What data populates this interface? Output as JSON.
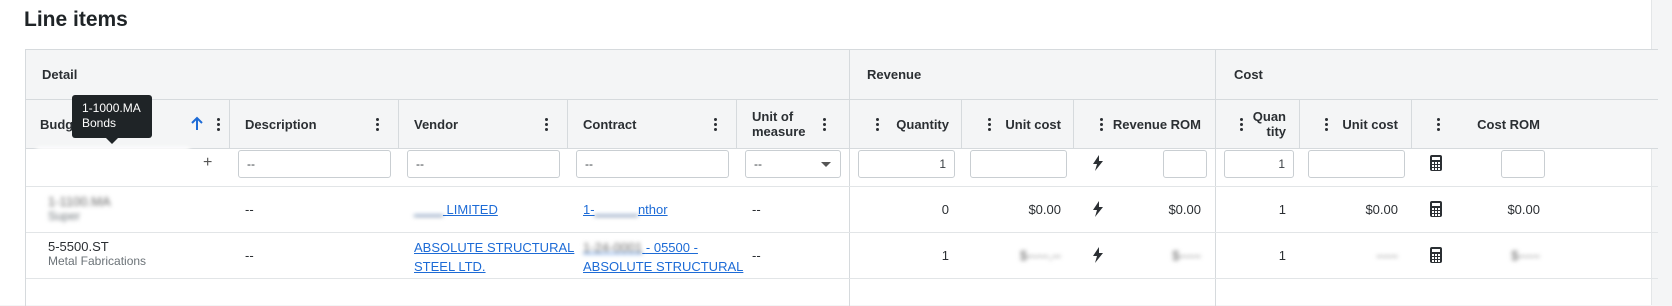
{
  "title": "Line items",
  "bands": {
    "detail": "Detail",
    "revenue": "Revenue",
    "cost": "Cost"
  },
  "columns": {
    "budget_code": "Budge",
    "description": "Description",
    "vendor": "Vendor",
    "contract": "Contract",
    "unit_of_measure_1": "Unit of",
    "unit_of_measure_2": "measure",
    "quantity": "Quantity",
    "unit_cost": "Unit cost",
    "revenue_rom": "Revenue ROM",
    "cost_quantity_1": "Quan",
    "cost_quantity_2": "tity",
    "cost_unit_cost": "Unit cost",
    "cost_rom": "Cost ROM"
  },
  "sort_icon": "arrow-up-icon",
  "tooltip": {
    "line1": "1-1000.MA",
    "line2": "Bonds"
  },
  "new_row": {
    "add_symbol": "+",
    "description_placeholder": "--",
    "vendor_placeholder": "--",
    "contract_placeholder": "--",
    "unit_select": "--",
    "quantity": "1",
    "cost_quantity": "1"
  },
  "rows": [
    {
      "code": "1-1100.MA",
      "code_sub": "Super",
      "description": "--",
      "vendor": "LIMITED",
      "contract": "1-",
      "contract_tail": "nthor",
      "unit": "--",
      "quantity": "0",
      "unit_cost": "$0.00",
      "revenue_rom": "$0.00",
      "cost_quantity": "1",
      "cost_unit_cost": "$0.00",
      "cost_rom": "$0.00"
    },
    {
      "code": "5-5500.ST",
      "code_sub": "Metal Fabrications",
      "description": "--",
      "vendor_1": "ABSOLUTE STRUCTURAL",
      "vendor_2": "STEEL LTD.",
      "contract_1": "- 05500 -",
      "contract_2": "ABSOLUTE STRUCTURAL",
      "unit": "--",
      "quantity": "1",
      "cost_quantity": "1"
    }
  ]
}
